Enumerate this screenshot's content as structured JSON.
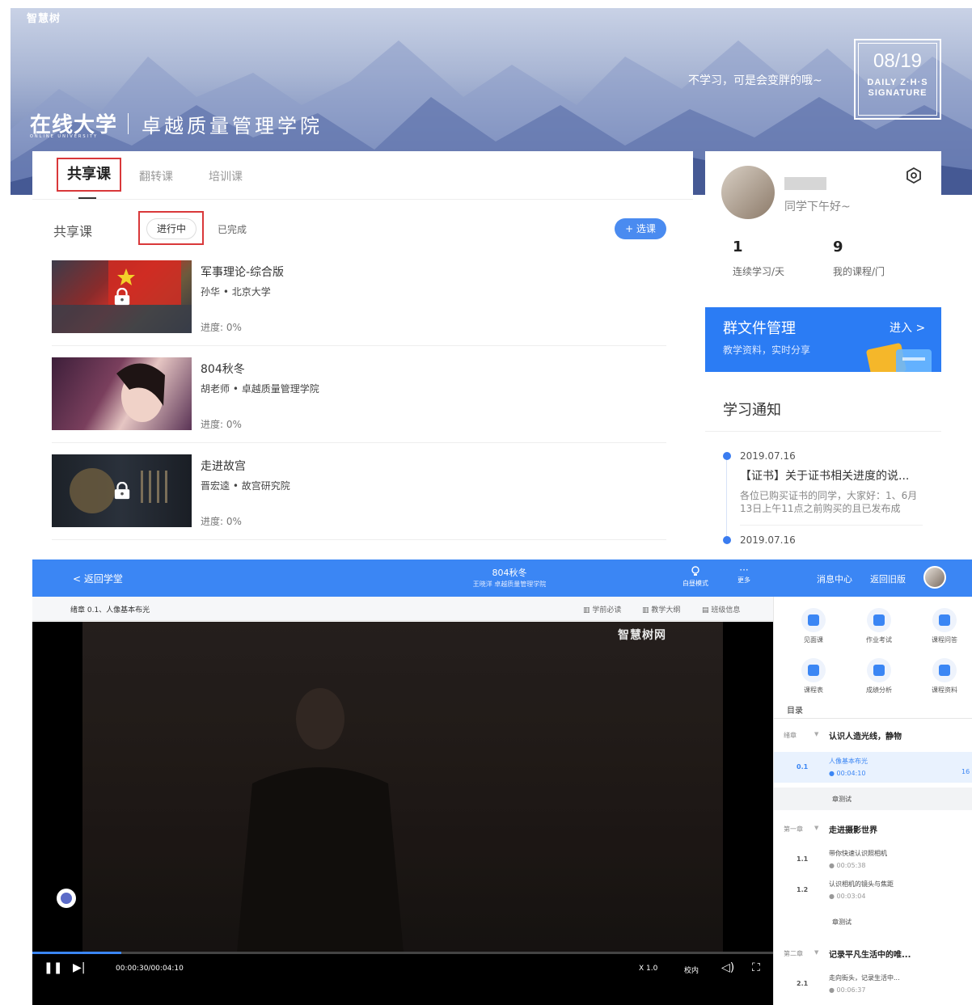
{
  "portal": {
    "logo_text": "智慧树",
    "brand": "在线大学",
    "brand_sub": "ONLINE UNIVERSITY",
    "college": "卓越质量管理学院",
    "slogan": "不学习，可是会变胖的哦~",
    "date": "08/19",
    "signature_line1": "DAILY Z·H·S",
    "signature_line2": "SIGNATURE",
    "tabs": [
      {
        "label": "共享课",
        "active": true
      },
      {
        "label": "翻转课",
        "active": false
      },
      {
        "label": "培训课",
        "active": false
      }
    ],
    "section_title": "共享课",
    "filters": {
      "in_progress": "进行中",
      "completed": "已完成"
    },
    "select_button": "+ 选课",
    "courses": [
      {
        "name": "军事理论-综合版",
        "teacher": "孙华 • 北京大学",
        "progress": "进度: 0%",
        "locked": true
      },
      {
        "name": "804秋冬",
        "teacher": "胡老师 • 卓越质量管理学院",
        "progress": "进度: 0%",
        "locked": false
      },
      {
        "name": "走进故宫",
        "teacher": "晋宏逵 • 故宫研究院",
        "progress": "进度: 0%",
        "locked": true
      }
    ],
    "profile": {
      "greeting": "同学下午好~",
      "stats": [
        {
          "value": "1",
          "label": "连续学习/天"
        },
        {
          "value": "9",
          "label": "我的课程/门"
        }
      ]
    },
    "group_files": {
      "title": "群文件管理",
      "subtitle": "教学资料，实时分享",
      "enter": "进入 >"
    },
    "notices": {
      "title": "学习通知",
      "items": [
        {
          "date": "2019.07.16",
          "headline": "【证书】关于证书相关进度的说...",
          "body": "各位已购买证书的同学，大家好：1、6月13日上午11点之前购买的且已发布成"
        },
        {
          "date": "2019.07.16"
        }
      ]
    }
  },
  "player": {
    "back": "< 返回学堂",
    "course_title": "804秋冬",
    "course_sub": "王晓洋  卓越质量管理学院",
    "toolbar": [
      {
        "icon": "lightbulb-icon",
        "label": "白昼模式"
      },
      {
        "icon": "more-icon",
        "label": "更多"
      }
    ],
    "links": {
      "messages": "消息中心",
      "old_version": "返回旧版"
    },
    "crumb": "绪章 0.1、人像基本布光",
    "crumb_links": [
      "学前必读",
      "教学大纲",
      "班级信息"
    ],
    "watermark": "智慧树网",
    "time": "00:00:30/00:04:10",
    "progress_fraction": 0.12,
    "speed": "X 1.0",
    "line": "校内",
    "tools": [
      "见面课",
      "作业考试",
      "课程问答",
      "课程表",
      "成绩分析",
      "课程资料"
    ],
    "toc_title": "目录",
    "toc": [
      {
        "type": "chapter",
        "no": "绪章",
        "name": "认识人造光线，静物"
      },
      {
        "type": "lesson",
        "no": "0.1",
        "name": "人像基本布光",
        "time": "00:04:10",
        "active": true,
        "badge": "16"
      },
      {
        "type": "quiz",
        "name": "章测试",
        "gray": true
      },
      {
        "type": "chapter",
        "no": "第一章",
        "name": "走进摄影世界"
      },
      {
        "type": "lesson",
        "no": "1.1",
        "name": "带你快速认识照相机",
        "time": "00:05:38"
      },
      {
        "type": "lesson",
        "no": "1.2",
        "name": "认识相机的镜头与焦距",
        "time": "00:03:04"
      },
      {
        "type": "quiz",
        "name": "章测试"
      },
      {
        "type": "chapter",
        "no": "第二章",
        "name": "记录平凡生活中的唯..."
      },
      {
        "type": "lesson",
        "no": "2.1",
        "name": "走向街头，记录生活中...",
        "time": "00:06:37"
      }
    ]
  }
}
